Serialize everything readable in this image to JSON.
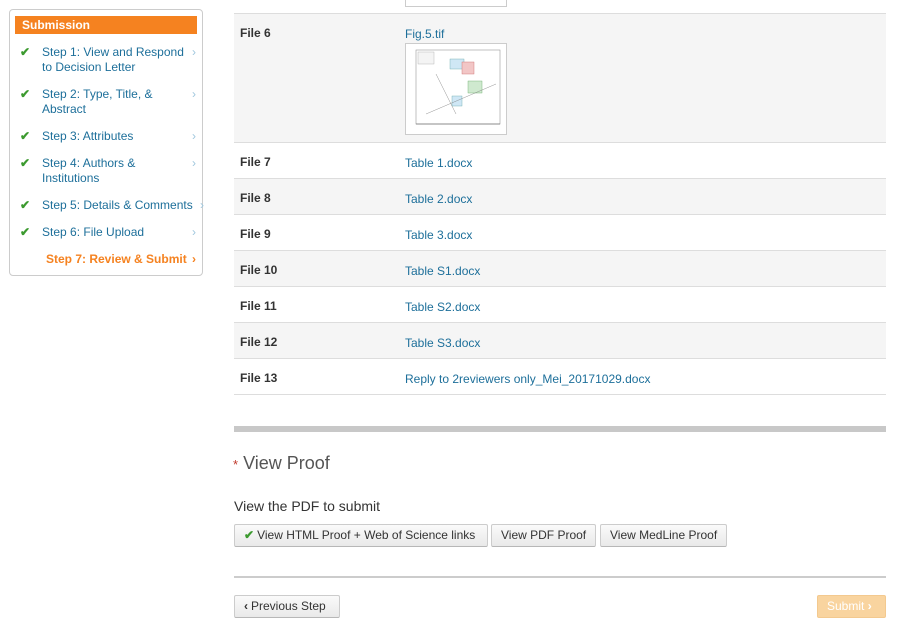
{
  "sidebar": {
    "title": "Submission",
    "steps": [
      {
        "label": "Step 1: View and Respond to Decision Letter",
        "done": true
      },
      {
        "label": "Step 2: Type, Title, & Abstract",
        "done": true
      },
      {
        "label": "Step 3: Attributes",
        "done": true
      },
      {
        "label": "Step 4: Authors & Institutions",
        "done": true
      },
      {
        "label": "Step 5: Details & Comments",
        "done": true
      },
      {
        "label": "Step 6: File Upload",
        "done": true
      },
      {
        "label": "Step 7: Review & Submit",
        "done": false,
        "current": true
      }
    ],
    "check_glyph": "✔",
    "chevron_glyph": "›"
  },
  "files": [
    {
      "name": "File 6",
      "link": "Fig.5.tif"
    },
    {
      "name": "File 7",
      "link": "Table 1.docx"
    },
    {
      "name": "File 8",
      "link": "Table 2.docx"
    },
    {
      "name": "File 9",
      "link": "Table 3.docx"
    },
    {
      "name": "File 10",
      "link": "Table S1.docx"
    },
    {
      "name": "File 11",
      "link": "Table S2.docx"
    },
    {
      "name": "File 12",
      "link": "Table S3.docx"
    },
    {
      "name": "File 13",
      "link": "Reply to 2reviewers only_Mei_20171029.docx"
    }
  ],
  "proof": {
    "required_mark": "*",
    "title": "View Proof",
    "subtitle": "View the PDF to submit",
    "buttons": {
      "html_proof": "View HTML Proof + Web of Science links",
      "pdf_proof": "View PDF Proof",
      "medline_proof": "View MedLine Proof"
    }
  },
  "nav": {
    "previous": "Previous Step",
    "submit": "Submit",
    "prev_glyph": "‹",
    "next_glyph": "›"
  },
  "colors": {
    "accent": "#f58220",
    "link": "#1d6f9a",
    "check": "#3c9a2f",
    "submit_disabled": "#f9d49f"
  }
}
